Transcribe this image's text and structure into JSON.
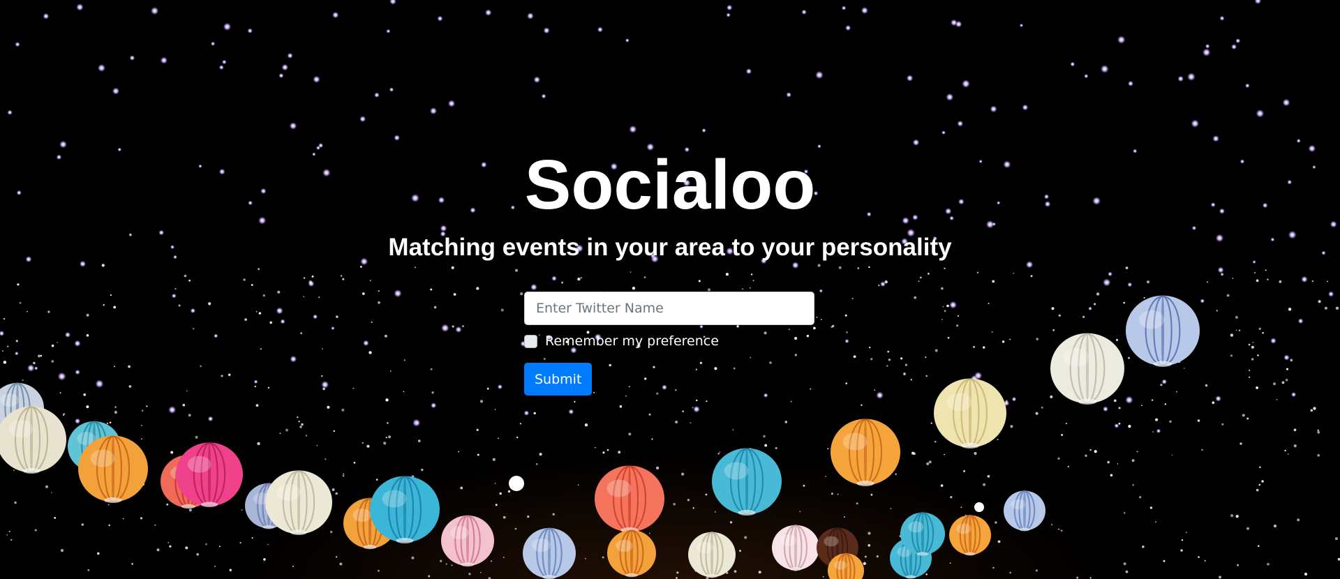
{
  "page": {
    "title": "Socialoo",
    "subtitle": "Matching events in your area to your personality"
  },
  "form": {
    "twitter_placeholder": "Enter Twitter Name",
    "twitter_value": "",
    "remember_label": "Remember my preference",
    "remember_checked": false,
    "submit_label": "Submit"
  },
  "colors": {
    "background": "#000000",
    "text": "#ffffff",
    "primary_button": "#007bff",
    "star_light": "#ffffff",
    "star_glow": "#c8a8ff"
  },
  "background_image": "night-sky-with-string-lights-and-paper-lanterns"
}
